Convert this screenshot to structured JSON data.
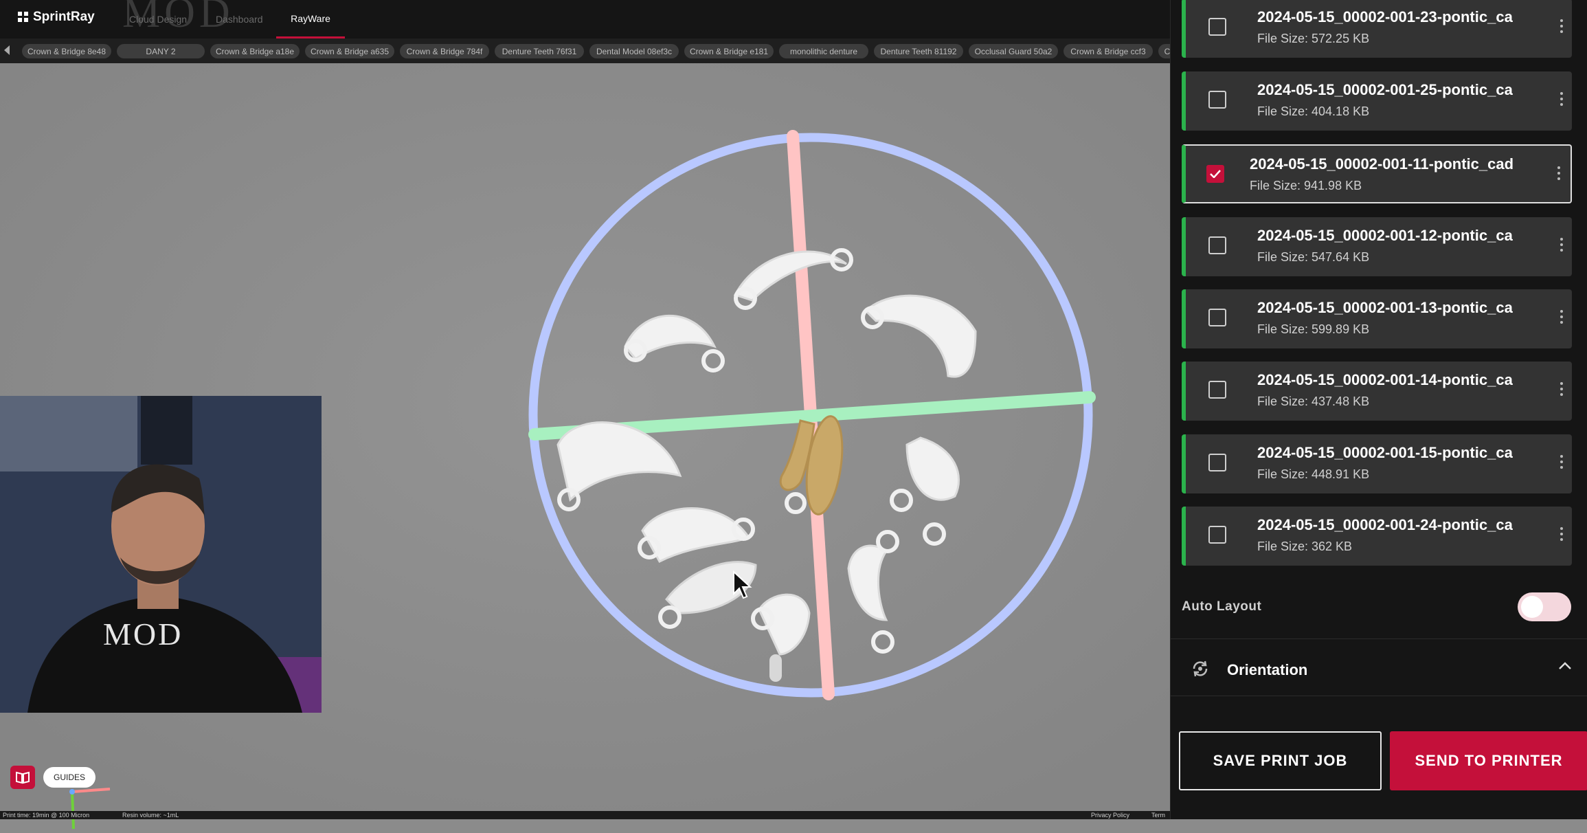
{
  "header": {
    "brand": "SprintRay",
    "nav": [
      {
        "label": "Cloud Design"
      },
      {
        "label": "Dashboard"
      },
      {
        "label": "RayWare"
      }
    ],
    "watermark": "MOD"
  },
  "file_tabs": [
    "Crown & Bridge 8e48",
    "DANY 2",
    "Crown & Bridge a18e",
    "Crown & Bridge a635",
    "Crown & Bridge 784f",
    "Denture Teeth 76f31",
    "Dental Model 08ef3c",
    "Crown & Bridge e181",
    "monolithic denture",
    "Denture Teeth 81192",
    "Occlusal Guard 50a2",
    "Crown & Bridge ccf3",
    "Cr"
  ],
  "files": [
    {
      "name": "2024-05-15_00002-001-23-pontic_ca",
      "size": "File Size: 572.25 KB",
      "checked": false
    },
    {
      "name": "2024-05-15_00002-001-25-pontic_ca",
      "size": "File Size: 404.18 KB",
      "checked": false
    },
    {
      "name": "2024-05-15_00002-001-11-pontic_cad",
      "size": "File Size: 941.98 KB",
      "checked": true
    },
    {
      "name": "2024-05-15_00002-001-12-pontic_ca",
      "size": "File Size: 547.64 KB",
      "checked": false
    },
    {
      "name": "2024-05-15_00002-001-13-pontic_ca",
      "size": "File Size: 599.89 KB",
      "checked": false
    },
    {
      "name": "2024-05-15_00002-001-14-pontic_ca",
      "size": "File Size: 437.48 KB",
      "checked": false
    },
    {
      "name": "2024-05-15_00002-001-15-pontic_ca",
      "size": "File Size: 448.91 KB",
      "checked": false
    },
    {
      "name": "2024-05-15_00002-001-24-pontic_ca",
      "size": "File Size: 362 KB",
      "checked": false
    }
  ],
  "panel": {
    "auto_layout_label": "Auto Layout",
    "auto_layout_on": false,
    "orientation_label": "Orientation",
    "save_label": "SAVE PRINT JOB",
    "send_label": "SEND TO PRINTER"
  },
  "viewport": {
    "guides_label": "GUIDES",
    "webcam_shirt_text": "MOD",
    "ring_color": "#b9c8ff",
    "x_axis_color": "#a8f0c0",
    "y_axis_color": "#ffc4c4",
    "selected_model_color": "#c9a868"
  },
  "status": {
    "print_time": "Print time: 19min @ 100 Micron",
    "resin_volume": "Resin volume: ~1mL",
    "privacy": "Privacy Policy",
    "terms": "Term"
  },
  "icons": {
    "brand": "grid-logo-icon",
    "guides": "book-icon",
    "orientation": "rotate-icon",
    "collapse": "chevron-up-icon",
    "card_menu": "kebab-menu-icon",
    "tabs_scroll": "arrow-left-icon"
  },
  "colors": {
    "accent": "#c4103a",
    "status_ok": "#2bb24c",
    "panel_bg": "#151515",
    "card_bg": "#333333"
  }
}
